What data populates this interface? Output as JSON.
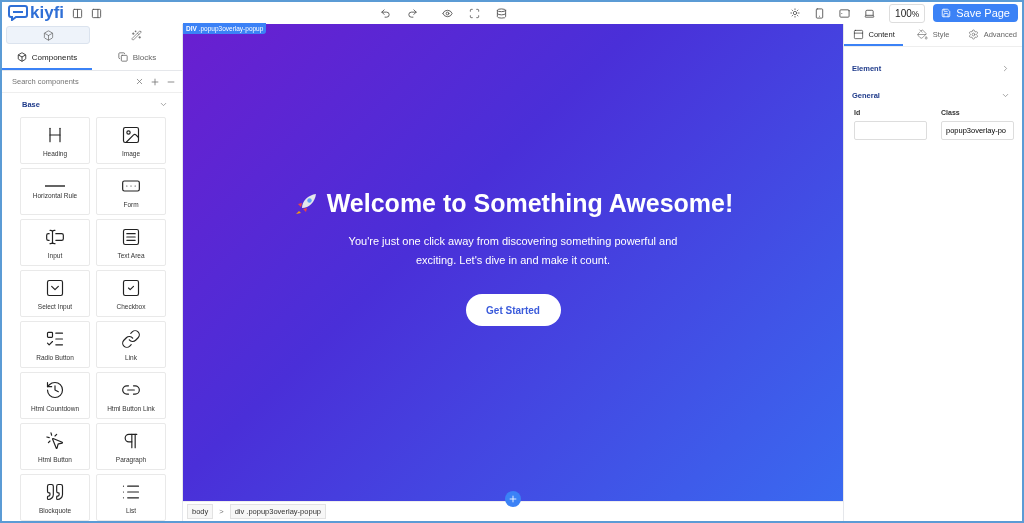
{
  "brand": "kiyfi",
  "sidebar": {
    "mode_tabs": [
      {
        "selected": true
      },
      {
        "selected": false
      }
    ],
    "tabs": [
      {
        "label": "Components",
        "selected": true
      },
      {
        "label": "Blocks",
        "selected": false
      }
    ],
    "search": {
      "placeholder": "Search components"
    },
    "section": {
      "title": "Base",
      "expanded": true
    },
    "components": [
      {
        "label": "Heading"
      },
      {
        "label": "Image"
      },
      {
        "label": "Horizontal Rule"
      },
      {
        "label": "Form"
      },
      {
        "label": "Input"
      },
      {
        "label": "Text Area"
      },
      {
        "label": "Select Input"
      },
      {
        "label": "Checkbox"
      },
      {
        "label": "Radio Button"
      },
      {
        "label": "Link"
      },
      {
        "label": "Html Countdown"
      },
      {
        "label": "Html Button Link"
      },
      {
        "label": "Html Button"
      },
      {
        "label": "Paragraph"
      },
      {
        "label": "Blockquote"
      },
      {
        "label": "List"
      }
    ]
  },
  "toolbar": {
    "zoom": "100",
    "zoom_unit": "%",
    "save": "Save Page"
  },
  "canvas": {
    "tag": "DIV",
    "selector": ".popup3overlay-popup",
    "heading": "Welcome to Something Awesome!",
    "text": "You're just one click away from discovering something powerful and exciting. Let's dive in and make it count.",
    "button": "Get Started"
  },
  "breadcrumbs": [
    "body",
    "div .popup3overlay-popup"
  ],
  "breadcrumb_separator": ">",
  "panel": {
    "tabs": [
      {
        "label": "Content",
        "selected": true
      },
      {
        "label": "Style",
        "selected": false
      },
      {
        "label": "Advanced",
        "selected": false
      }
    ],
    "sections": [
      {
        "title": "Element",
        "expanded": false
      },
      {
        "title": "General",
        "expanded": true
      }
    ],
    "fields": [
      {
        "label": "Id"
      },
      {
        "label": "Class",
        "value": "popup3overlay-po"
      }
    ]
  }
}
